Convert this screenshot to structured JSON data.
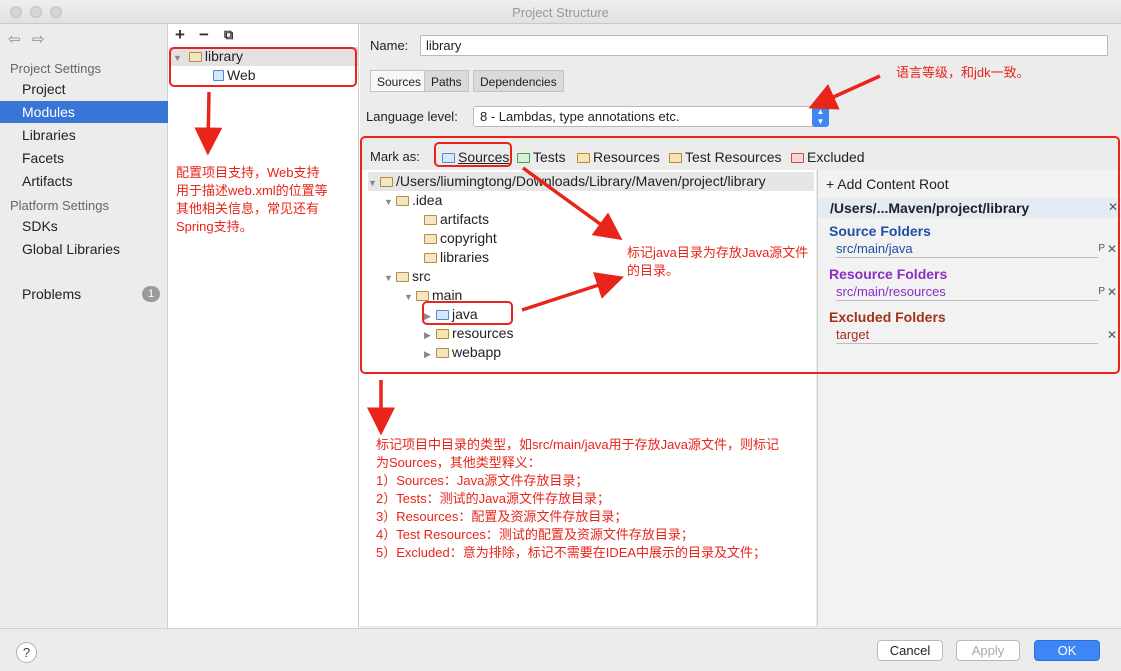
{
  "window": {
    "title": "Project Structure"
  },
  "sidebar": {
    "project_settings": "Project Settings",
    "items": [
      "Project",
      "Modules",
      "Libraries",
      "Facets",
      "Artifacts"
    ],
    "platform_settings": "Platform Settings",
    "platform_items": [
      "SDKs",
      "Global Libraries"
    ],
    "problems": {
      "label": "Problems",
      "count": "1"
    }
  },
  "module_tree": {
    "toolbar": {
      "add": "+",
      "remove": "−"
    },
    "root": "library",
    "child": "Web"
  },
  "details": {
    "name_label": "Name:",
    "name_value": "library",
    "tabs": [
      "Sources",
      "Paths",
      "Dependencies"
    ],
    "language_level_label": "Language level:",
    "language_level_value": "8 - Lambdas, type annotations etc.",
    "mark_as_label": "Mark as:",
    "mark_as": [
      "Sources",
      "Tests",
      "Resources",
      "Test Resources",
      "Excluded"
    ],
    "tree": {
      "root": "/Users/liumingtong/Downloads/Library/Maven/project/library",
      "idea": ".idea",
      "idea_children": [
        "artifacts",
        "copyright",
        "libraries"
      ],
      "src": "src",
      "main": "main",
      "java": "java",
      "resources": "resources",
      "webapp": "webapp"
    },
    "content_root": {
      "add_label": "Add Content Root",
      "path": "/Users/...Maven/project/library",
      "source_folders_label": "Source Folders",
      "source_folder": "src/main/java",
      "resource_folders_label": "Resource Folders",
      "resource_folder": "src/main/resources",
      "excluded_folders_label": "Excluded Folders",
      "excluded_folder": "target"
    }
  },
  "buttons": {
    "help": "?",
    "cancel": "Cancel",
    "apply": "Apply",
    "ok": "OK"
  },
  "annotations": {
    "facets_note": [
      "配置项目支持，Web支持",
      "用于描述web.xml的位置等",
      "其他相关信息，常见还有",
      "Spring支持。"
    ],
    "language_note": "语言等级，和jdk一致。",
    "java_note": [
      "标记java目录为存放Java源文件",
      "的目录。"
    ],
    "markas_note": [
      "标记项目中目录的类型，如src/main/java用于存放Java源文件，则标记",
      "为Sources，其他类型释义：",
      "1）Sources：Java源文件存放目录；",
      "2）Tests：测试的Java源文件存放目录；",
      "3）Resources：配置及资源文件存放目录；",
      "4）Test Resources：测试的配置及资源文件存放目录；",
      "5）Excluded：意为排除，标记不需要在IDEA中展示的目录及文件；"
    ]
  },
  "colors": {
    "selection": "#3875d7",
    "annotation_red": "#e8241b",
    "source_folders": "#1d4fa3",
    "resource_folders": "#8a2fc4",
    "excluded_folders": "#a3321c",
    "ok_button": "#3e86f5"
  }
}
